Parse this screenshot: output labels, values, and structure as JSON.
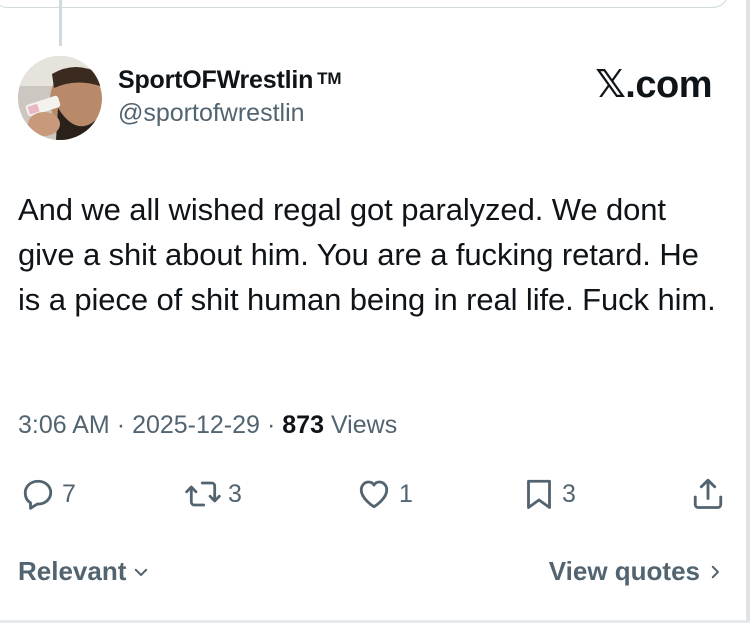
{
  "tweet": {
    "author": {
      "display_name": "SportOFWrestlin",
      "trademark": "TM",
      "handle": "@sportofwrestlin"
    },
    "brand": "𝕏.com",
    "text": "And we all wished regal got paralyzed. We dont give a shit about him. You are a fucking retard. He is a piece of shit human being in real life. Fuck him.",
    "meta": {
      "time": "3:06 AM",
      "separator": "·",
      "date": "2025-12-29",
      "views_count": "873",
      "views_label": "Views"
    },
    "actions": {
      "replies": "7",
      "reposts": "3",
      "likes": "1",
      "bookmarks": "3"
    },
    "footer": {
      "sort_label": "Relevant",
      "quotes_label": "View quotes"
    },
    "icons": {
      "reply": "reply-icon",
      "repost": "repost-icon",
      "like": "heart-icon",
      "bookmark": "bookmark-icon",
      "share": "share-icon"
    },
    "colors": {
      "text": "#0f1419",
      "secondary": "#536471",
      "border": "#cfd9de"
    }
  }
}
